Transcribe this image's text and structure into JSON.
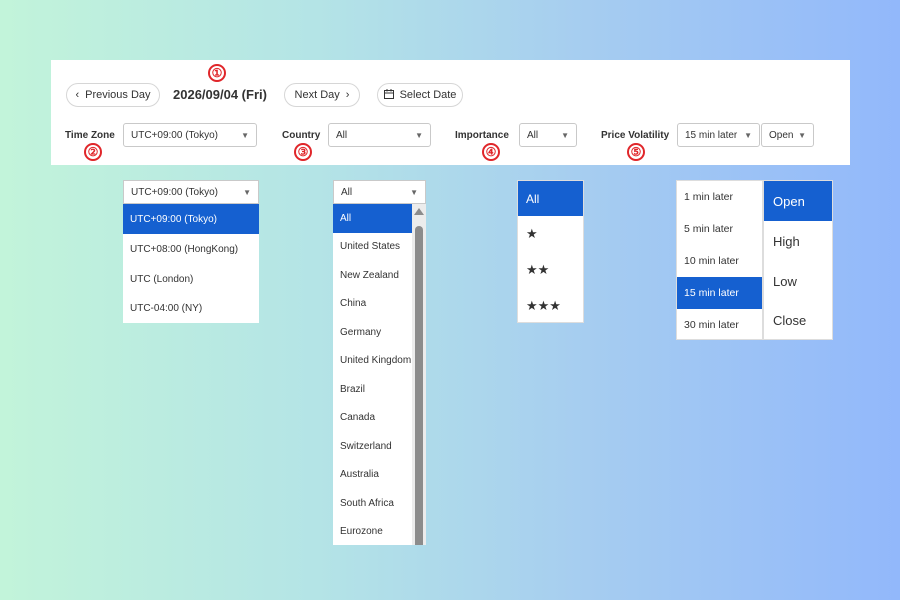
{
  "toolbar": {
    "prev_day": "Previous Day",
    "date": "2026/09/04 (Fri)",
    "next_day": "Next Day",
    "select_date": "Select Date"
  },
  "filters": {
    "timezone": {
      "label": "Time Zone",
      "value": "UTC+09:00 (Tokyo)"
    },
    "country": {
      "label": "Country",
      "value": "All"
    },
    "importance": {
      "label": "Importance",
      "value": "All"
    },
    "volatility": {
      "label": "Price Volatility",
      "time_value": "15 min later",
      "price_value": "Open"
    }
  },
  "markers": [
    "①",
    "②",
    "③",
    "④",
    "⑤"
  ],
  "timezone_dropdown": {
    "header": "UTC+09:00 (Tokyo)",
    "options": [
      "UTC+09:00 (Tokyo)",
      "UTC+08:00 (HongKong)",
      "UTC (London)",
      "UTC-04:00 (NY)"
    ],
    "selected_index": 0
  },
  "country_dropdown": {
    "header": "All",
    "options": [
      "All",
      "United States",
      "New Zealand",
      "China",
      "Germany",
      "United Kingdom",
      "Brazil",
      "Canada",
      "Switzerland",
      "Australia",
      "South Africa",
      "Eurozone"
    ],
    "selected_index": 0
  },
  "importance_dropdown": {
    "options": [
      "All",
      "★",
      "★★",
      "★★★"
    ],
    "selected_index": 0
  },
  "volatility_time_dropdown": {
    "options": [
      "1 min later",
      "5 min later",
      "10 min later",
      "15 min later",
      "30 min later"
    ],
    "selected_index": 3
  },
  "volatility_price_dropdown": {
    "options": [
      "Open",
      "High",
      "Low",
      "Close"
    ],
    "selected_index": 0
  },
  "colors": {
    "accent": "#1560d0",
    "marker": "#e0262a"
  }
}
